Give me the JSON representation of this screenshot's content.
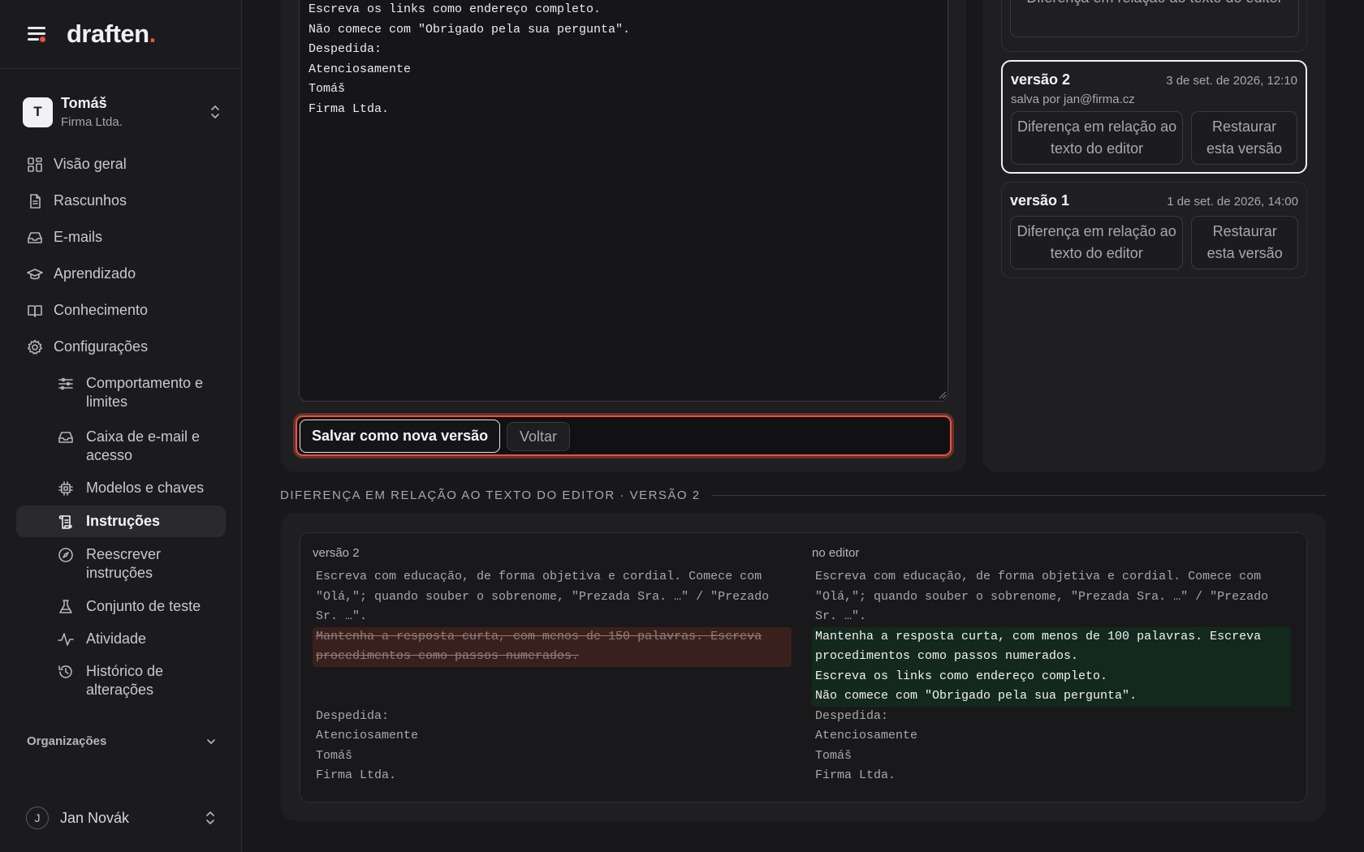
{
  "brand": {
    "name": "draften",
    "dot": "."
  },
  "org": {
    "initial": "T",
    "name": "Tomáš",
    "company": "Firma Ltda."
  },
  "nav": {
    "items": [
      {
        "label": "Visão geral",
        "icon": "grid-icon"
      },
      {
        "label": "Rascunhos",
        "icon": "document-icon"
      },
      {
        "label": "E-mails",
        "icon": "inbox-icon"
      },
      {
        "label": "Aprendizado",
        "icon": "graduation-cap-icon"
      },
      {
        "label": "Conhecimento",
        "icon": "book-icon"
      },
      {
        "label": "Configurações",
        "icon": "gear-icon"
      }
    ],
    "sub_items": [
      {
        "label": "Comportamento e limites",
        "icon": "sliders-icon"
      },
      {
        "label": "Caixa de e-mail e acesso",
        "icon": "inbox-icon"
      },
      {
        "label": "Modelos e chaves",
        "icon": "cpu-icon"
      },
      {
        "label": "Instruções",
        "icon": "scroll-icon",
        "active": true
      },
      {
        "label": "Reescrever instruções",
        "icon": "compass-icon"
      },
      {
        "label": "Conjunto de teste",
        "icon": "flask-icon"
      },
      {
        "label": "Atividade",
        "icon": "activity-icon"
      },
      {
        "label": "Histórico de alterações",
        "icon": "history-icon"
      }
    ],
    "section_label": "Organizações"
  },
  "user": {
    "initial": "J",
    "name": "Jan Novák"
  },
  "editor": {
    "text": "Escreva os links como endereço completo.\nNão comece com \"Obrigado pela sua pergunta\".\nDespedida:\nAtenciosamente\nTomáš\nFirma Ltda.",
    "save_label": "Salvar como nova versão",
    "back_label": "Voltar"
  },
  "versions": {
    "top_button": "Diferença em relação ao texto do editor",
    "list": [
      {
        "title": "versão 2",
        "date": "3 de set. de 2026, 12:10",
        "by": "salva por jan@firma.cz",
        "diff_label": "Diferença em relação ao texto do editor",
        "restore_label": "Restaurar esta versão",
        "selected": true
      },
      {
        "title": "versão 1",
        "date": "1 de set. de 2026, 14:00",
        "diff_label": "Diferença em relação ao texto do editor",
        "restore_label": "Restaurar esta versão",
        "selected": false
      }
    ]
  },
  "diff": {
    "heading": "DIFERENÇA EM RELAÇÃO AO TEXTO DO EDITOR · VERSÃO 2",
    "left_label": "versão 2",
    "right_label": "no editor",
    "common_top": "Escreva com educação, de forma objetiva e cordial. Comece com\n\"Olá,\"; quando souber o sobrenome, \"Prezada Sra. …\" / \"Prezado\nSr. …\".",
    "removed": "Mantenha a resposta curta, com menos de 150 palavras. Escreva\nprocedimentos como passos numerados.",
    "added": "Mantenha a resposta curta, com menos de 100 palavras. Escreva\nprocedimentos como passos numerados.\nEscreva os links como endereço completo.\nNão comece com \"Obrigado pela sua pergunta\".",
    "common_bottom": "Despedida:\nAtenciosamente\nTomáš\nFirma Ltda."
  },
  "colors": {
    "accent": "#e5533d",
    "added_bg": "#14291d",
    "removed_bg": "#3a201d"
  }
}
